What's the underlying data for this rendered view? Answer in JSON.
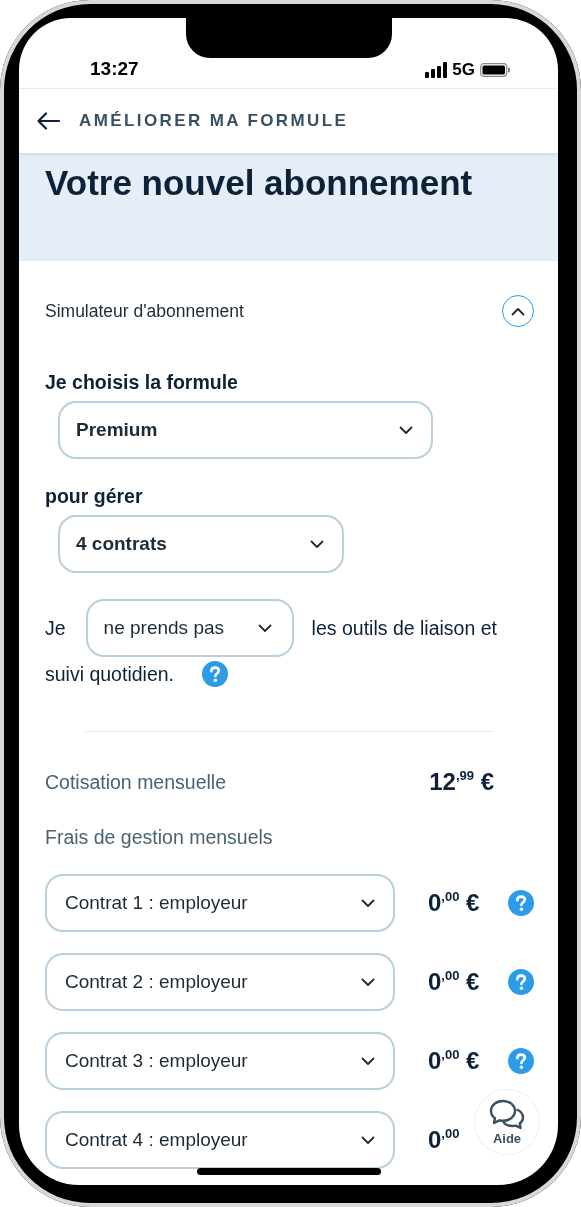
{
  "status_bar": {
    "time": "13:27",
    "network": "5G"
  },
  "header": {
    "title": "AMÉLIORER MA FORMULE"
  },
  "hero": {
    "title": "Votre nouvel abonnement"
  },
  "simulator": {
    "title": "Simulateur d'abonnement",
    "expanded": true,
    "formula": {
      "label": "Je choisis la formule",
      "value": "Premium"
    },
    "manage": {
      "label": "pour gérer",
      "value": "4 contrats"
    },
    "tools": {
      "prefix": "Je",
      "value": "ne prends pas",
      "suffix": "les outils de liaison et",
      "continuation": "suivi quotidien."
    },
    "cotisation": {
      "label": "Cotisation mensuelle",
      "price": "12$^{,99}$ €"
    },
    "fees": {
      "label": "Frais de gestion mensuels"
    },
    "contracts": [
      {
        "value": "Contrat 1 : employeur",
        "price": "0$^{,00}$ €",
        "help": true
      },
      {
        "value": "Contrat 2 : employeur",
        "price": "0$^{,00}$ €",
        "help": true
      },
      {
        "value": "Contrat 3 : employeur",
        "price": "0$^{,00}$ €",
        "help": true
      },
      {
        "value": "Contrat 4 : employeur",
        "price": "0$^{,00}$",
        "help": false
      }
    ]
  },
  "help_button": {
    "label": "Aide"
  }
}
